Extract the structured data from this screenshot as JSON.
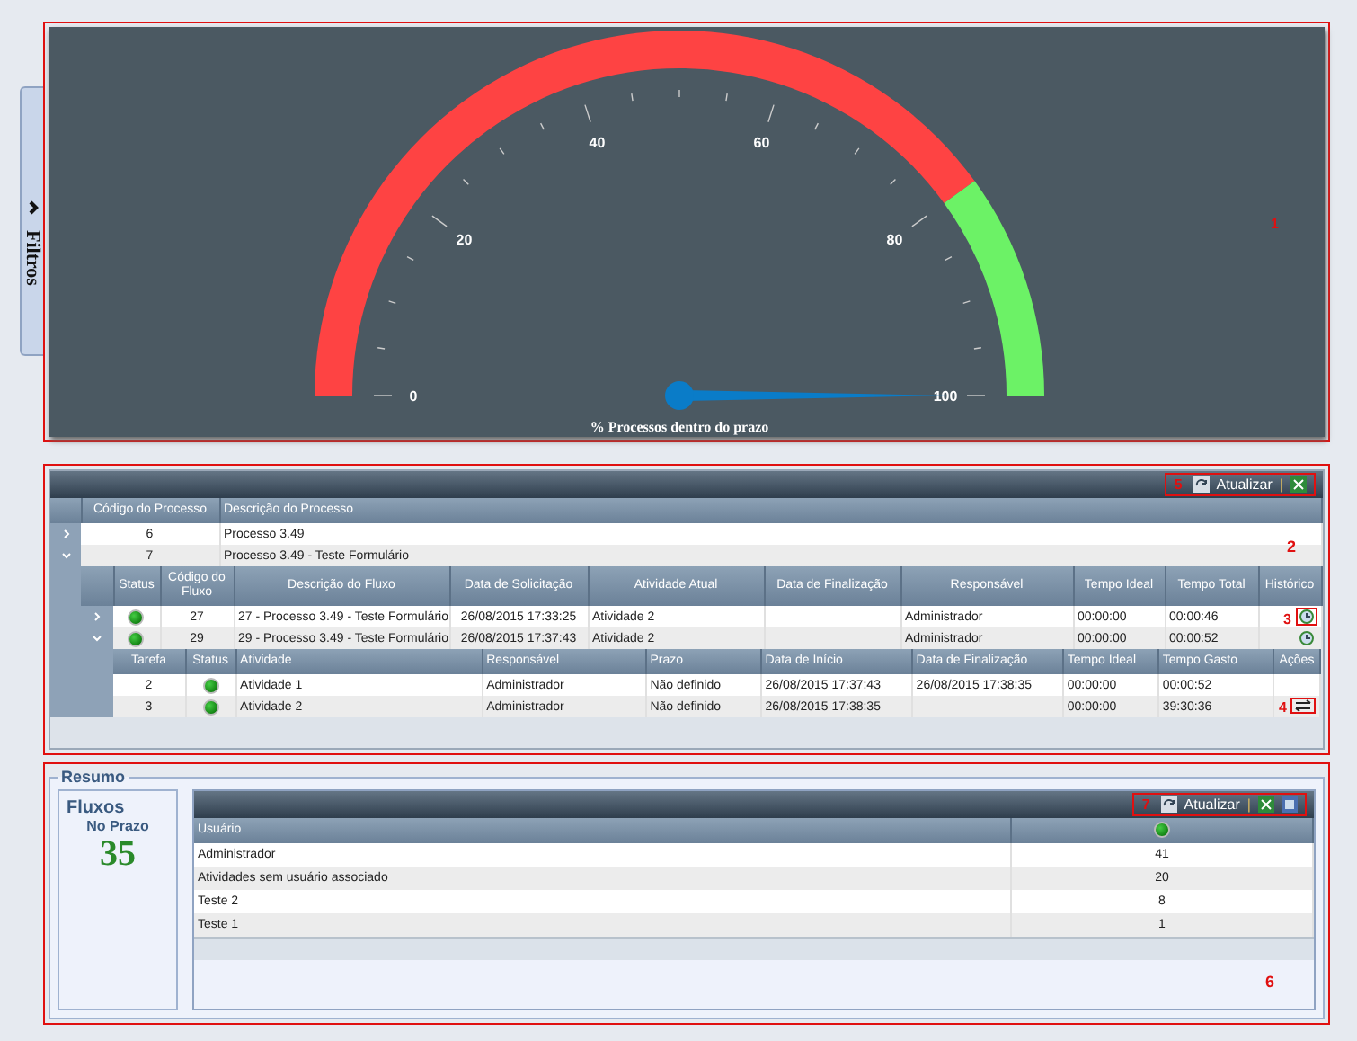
{
  "sidebar_tab": {
    "label": "Filtros"
  },
  "gauge": {
    "title": "% Processos dentro do prazo",
    "tick_labels": [
      "0",
      "20",
      "40",
      "60",
      "80",
      "100"
    ],
    "level": 1.0,
    "marker": "1"
  },
  "process_grid": {
    "marker": "2",
    "toolbar": {
      "marker": "5",
      "refresh_label": "Atualizar",
      "separator": "|",
      "highlighted": true
    },
    "columns": [
      "Código do Processo",
      "Descrição do Processo"
    ],
    "rows": [
      {
        "code": "6",
        "description": "Processo 3.49",
        "expanded": false
      },
      {
        "code": "7",
        "description": "Processo 3.49 - Teste Formulário",
        "expanded": true
      }
    ],
    "flow_columns": [
      "Status",
      "Código do Fluxo",
      "Descrição do Fluxo",
      "Data de Solicitação",
      "Atividade Atual",
      "Data de Finalização",
      "Responsável",
      "Tempo Ideal",
      "Tempo Total",
      "Histórico"
    ],
    "flows": [
      {
        "expanded": false,
        "code": "27",
        "description": "27 - Processo 3.49 - Teste Formulário",
        "requested": "26/08/2015 17:33:25",
        "activity": "Atividade 2",
        "owner": "Administrador",
        "ideal": "00:00:00",
        "total": "00:00:46",
        "marker": "3"
      },
      {
        "expanded": true,
        "code": "29",
        "description": "29 - Processo 3.49 - Teste Formulário",
        "requested": "26/08/2015 17:37:43",
        "activity": "Atividade 2",
        "owner": "Administrador",
        "ideal": "00:00:00",
        "total": "00:00:52"
      }
    ],
    "task_columns": [
      "Tarefa",
      "Status",
      "Atividade",
      "Responsável",
      "Prazo",
      "Data de Início",
      "Data de Finalização",
      "Tempo Ideal",
      "Tempo Gasto",
      "Ações"
    ],
    "tasks": [
      {
        "task": "2",
        "activity": "Atividade 1",
        "owner": "Administrador",
        "deadline": "Não definido",
        "start": "26/08/2015 17:37:43",
        "end": "26/08/2015 17:38:35",
        "ideal": "00:00:00",
        "spent": "00:00:52",
        "has_action": false
      },
      {
        "task": "3",
        "activity": "Atividade 2",
        "owner": "Administrador",
        "deadline": "Não definido",
        "start": "26/08/2015 17:38:35",
        "ideal": "00:00:00",
        "spent": "39:30:36",
        "has_action": true,
        "marker": "4"
      }
    ]
  },
  "summary": {
    "legend": "Resumo",
    "card": {
      "title": "Fluxos",
      "subtitle": "No Prazo",
      "value": "35"
    },
    "grid": {
      "marker": "6",
      "toolbar": {
        "marker": "7",
        "refresh_label": "Atualizar",
        "separator": "|",
        "highlighted": true
      },
      "columns": [
        "Usuário"
      ],
      "rows": [
        {
          "user": "Administrador",
          "count": "41"
        },
        {
          "user": "Atividades sem usuário associado",
          "count": "20"
        },
        {
          "user": "Teste 2",
          "count": "8"
        },
        {
          "user": "Teste 1",
          "count": "1"
        }
      ]
    }
  }
}
